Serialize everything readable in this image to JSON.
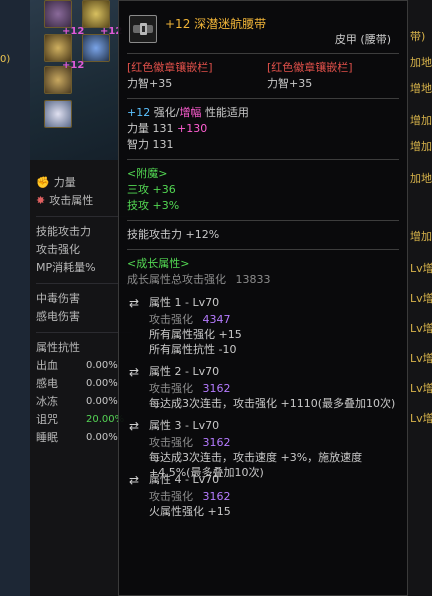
{
  "tooltip": {
    "title": "+12 深潜迷航腰带",
    "subtitle": "皮甲 (腰带)",
    "sockets": [
      {
        "label": "[红色徽章镶嵌栏]",
        "stat": "力智+35"
      },
      {
        "label": "[红色徽章镶嵌栏]",
        "stat": "力智+35"
      }
    ],
    "enhance": {
      "prefix": "+12",
      "enhance_word": "强化",
      "slash": "/",
      "amplify_word": "增幅",
      "suffix": "性能适用",
      "str_label": "力量 131",
      "str_bonus": "+130",
      "int_label": "智力 131"
    },
    "enchant": {
      "header": "<附魔>",
      "line1": "三攻 +36",
      "line2": "技攻 +3%"
    },
    "skill_attack": "技能攻击力 +12%",
    "growth": {
      "header": "<成长属性>",
      "total_label": "成长属性总攻击强化",
      "total_value": "13833",
      "attrs": [
        {
          "title": "属性 1 - Lv70",
          "atk_label": "攻击强化",
          "atk_value": "4347",
          "lines": [
            "所有属性强化 +15",
            "所有属性抗性 -10"
          ]
        },
        {
          "title": "属性 2 - Lv70",
          "atk_label": "攻击强化",
          "atk_value": "3162",
          "lines": [
            "每达成3次连击，攻击强化 +1110(最多叠加10次)"
          ]
        },
        {
          "title": "属性 3 - Lv70",
          "atk_label": "攻击强化",
          "atk_value": "3162",
          "lines": [
            "每达成3次连击，攻击速度 +3%，施放速度 +4.5%(最多叠加10次)"
          ]
        },
        {
          "title": "属性 4 - Lv70",
          "atk_label": "攻击强化",
          "atk_value": "3162",
          "lines": [
            "火属性强化 +15"
          ]
        }
      ]
    }
  },
  "background": {
    "plus_tags": [
      "+12",
      "+12",
      "+12"
    ],
    "sidebar_label": "0)",
    "stats": {
      "str_label": "力量",
      "atk_attr_label": "攻击属性",
      "skill_atk_label": "技能攻击力",
      "atk_enh_label": "攻击强化",
      "mp_label": "MP消耗量%",
      "poison_label": "中毒伤害",
      "shock_label": "感电伤害",
      "resist_header": "属性抗性",
      "resists": [
        {
          "label": "出血",
          "value": "0.00%"
        },
        {
          "label": "感电",
          "value": "0.00%"
        },
        {
          "label": "冰冻",
          "value": "0.00%"
        },
        {
          "label": "诅咒",
          "value": "20.00%"
        },
        {
          "label": "睡眠",
          "value": "0.00%"
        }
      ]
    },
    "right_col": [
      "带)",
      "加地",
      "增地",
      "增加",
      "增加",
      "加地",
      "增加",
      "Lv增",
      "Lv增",
      "Lv增",
      "Lv增",
      "Lv增",
      "Lv增"
    ]
  }
}
